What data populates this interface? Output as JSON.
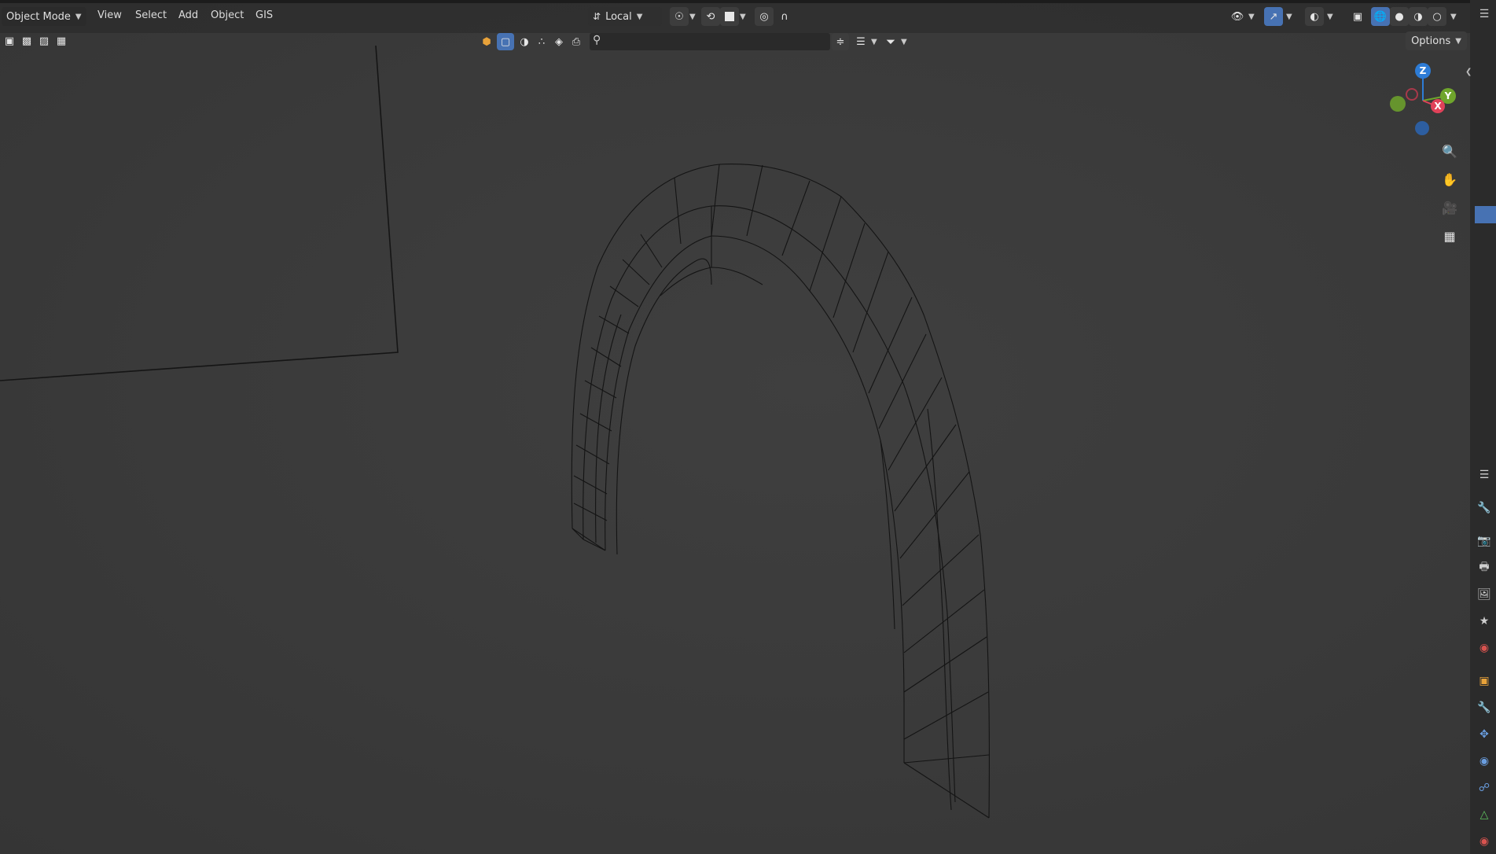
{
  "header": {
    "mode": "Object Mode",
    "menus": [
      "View",
      "Select",
      "Add",
      "Object",
      "GIS"
    ],
    "orientation": "Local",
    "options_label": "Options"
  },
  "gizmo": {
    "z": "Z",
    "y": "Y",
    "x": "X"
  },
  "icons": {
    "left_toolbar": [
      "select-box-icon",
      "select-extend-icon",
      "select-subtract-icon",
      "select-intersect-icon"
    ],
    "filter_bar": [
      "object-type-icon",
      "mesh-visibility-icon",
      "sphere-icon",
      "particles-icon",
      "material-icon",
      "render-icon",
      "search-icon",
      "filter-icon"
    ],
    "navigation": [
      "zoom-icon",
      "pan-hand-icon",
      "camera-icon",
      "grid-icon"
    ],
    "properties_tabs": [
      "tool-icon",
      "render-icon",
      "output-icon",
      "view-layer-icon",
      "scene-icon",
      "world-icon",
      "object-icon",
      "modifier-icon",
      "particles-icon",
      "physics-icon",
      "constraints-icon",
      "data-icon",
      "material-icon"
    ]
  },
  "colors": {
    "accent": "#4772b3",
    "axis_x": "#e04259",
    "axis_y": "#6fa52c",
    "axis_z": "#2d7cd6"
  }
}
